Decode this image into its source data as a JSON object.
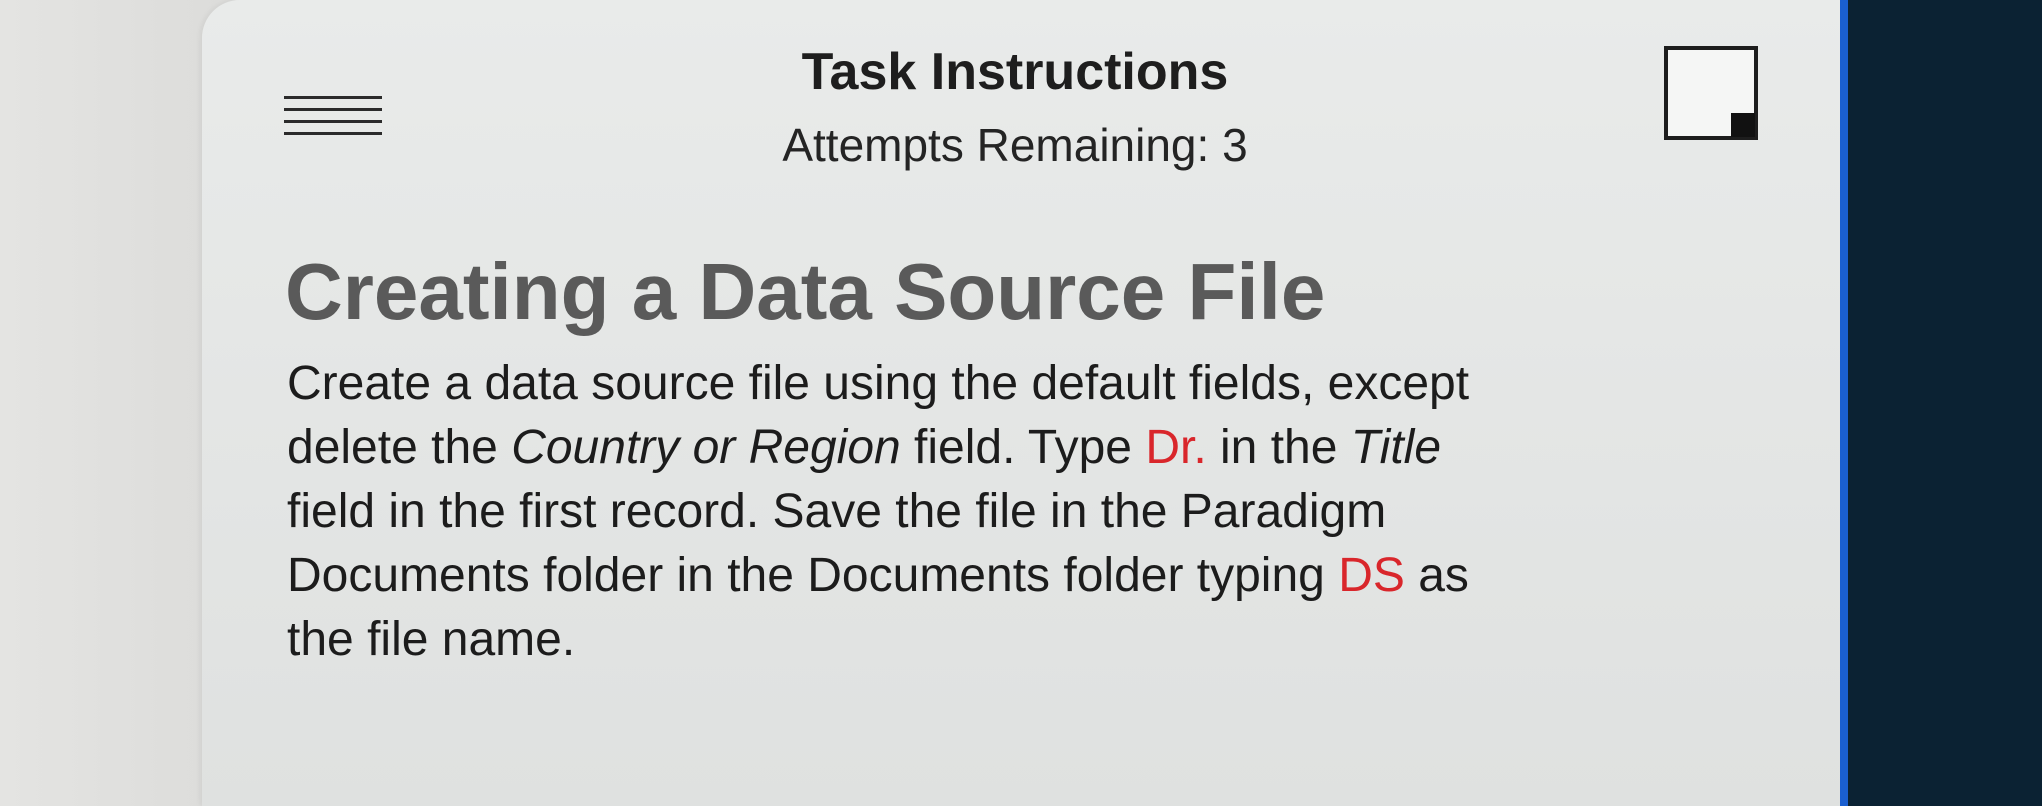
{
  "header": {
    "title": "Task Instructions",
    "attempts": "Attempts Remaining: 3"
  },
  "icons": {
    "menu": "hamburger-menu-icon",
    "window": "window-resize-icon"
  },
  "task": {
    "heading": "Creating a Data Source File",
    "lines": [
      [
        "Create a data source file using the default fields, except"
      ],
      [
        "delete the ",
        "Country or Region",
        " field. Type ",
        "Dr.",
        " in the ",
        "Title"
      ],
      [
        "field in the first record. Save the file in the Paradigm"
      ],
      [
        "Documents folder in the Documents folder typing ",
        "DS",
        " as"
      ],
      [
        "the file name."
      ]
    ]
  },
  "colors": {
    "highlight": "#d9262b",
    "panel": "#e6e8e7",
    "frame_accent": "#1a5fd0"
  }
}
